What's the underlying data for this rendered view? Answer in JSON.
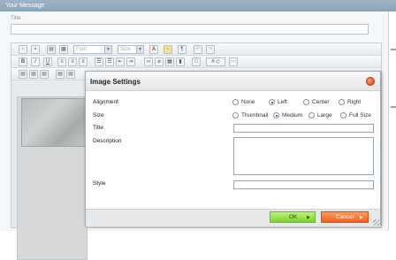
{
  "header": {
    "title": "Your Message"
  },
  "form": {
    "title_label": "Title:",
    "title_value": ""
  },
  "toolbar": {
    "font_placeholder": "Font",
    "size_placeholder": "Size",
    "row1_icons": [
      "new-doc-icon",
      "image-icon",
      "paste-icon",
      "paste-word-icon",
      "font-select",
      "size-select",
      "text-color-icon",
      "highlight-icon",
      "paragraph-icon",
      "undo-icon",
      "redo-icon"
    ],
    "row2_labels": {
      "bold": "B",
      "italic": "I",
      "underline": "U",
      "source": "# ◇"
    }
  },
  "dialog": {
    "title": "Image Settings",
    "alignment": {
      "label": "Alignment",
      "options": [
        "None",
        "Left",
        "Center",
        "Right"
      ],
      "selected": "Left"
    },
    "size": {
      "label": "Size",
      "options": [
        "Thumbnail",
        "Medium",
        "Large",
        "Full Size"
      ],
      "selected": "Medium"
    },
    "title_field": {
      "label": "Title",
      "value": ""
    },
    "description_field": {
      "label": "Description",
      "value": ""
    },
    "style_field": {
      "label": "Style",
      "value": ""
    },
    "ok_label": "OK",
    "cancel_label": "Cancel",
    "colors": {
      "ok": "#7fd42c",
      "cancel": "#f2611c",
      "close": "#d9430e"
    }
  }
}
